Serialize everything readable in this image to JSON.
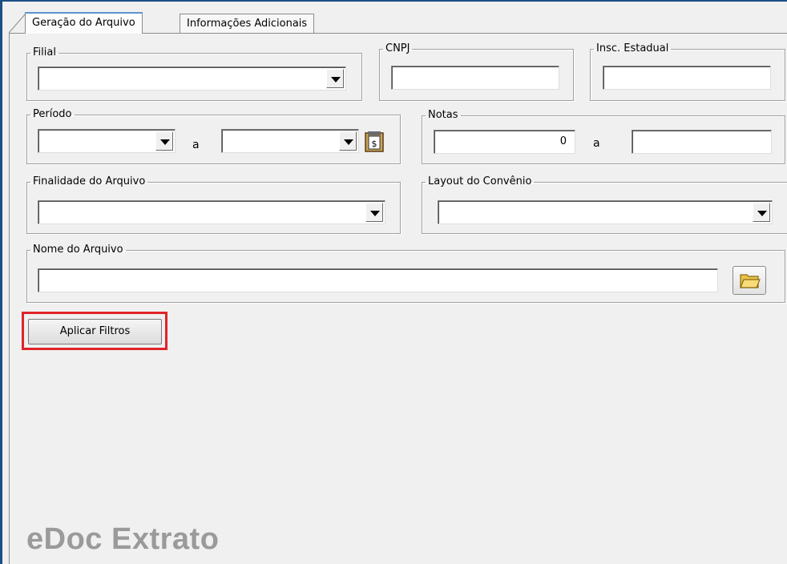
{
  "tabs": [
    {
      "label": "Geração do Arquivo",
      "active": true
    },
    {
      "label": "Informações Adicionais",
      "active": false
    }
  ],
  "filters": {
    "filial": {
      "label": "Filial",
      "value": ""
    },
    "cnpj": {
      "label": "CNPJ",
      "value": ""
    },
    "insc_estadual": {
      "label": "Insc. Estadual",
      "value": ""
    },
    "periodo": {
      "label": "Período",
      "from": "",
      "separator": "a",
      "to": ""
    },
    "notas": {
      "label": "Notas",
      "from": "0",
      "separator": "a",
      "to": ""
    },
    "finalidade": {
      "label": "Finalidade do Arquivo",
      "value": ""
    },
    "layout_convenio": {
      "label": "Layout do Convênio",
      "value": ""
    },
    "nome_arquivo": {
      "label": "Nome do Arquivo",
      "value": ""
    }
  },
  "actions": {
    "apply_filters_label": "Aplicar Filtros"
  },
  "branding": {
    "watermark": "eDoc Extrato"
  },
  "colors": {
    "window_border": "#1c4f86",
    "highlight": "#e0242a",
    "background": "#f0f0f0"
  },
  "icons": {
    "calendar": "calendar-icon",
    "folder": "folder-open-icon",
    "dropdown": "chevron-down-icon"
  }
}
